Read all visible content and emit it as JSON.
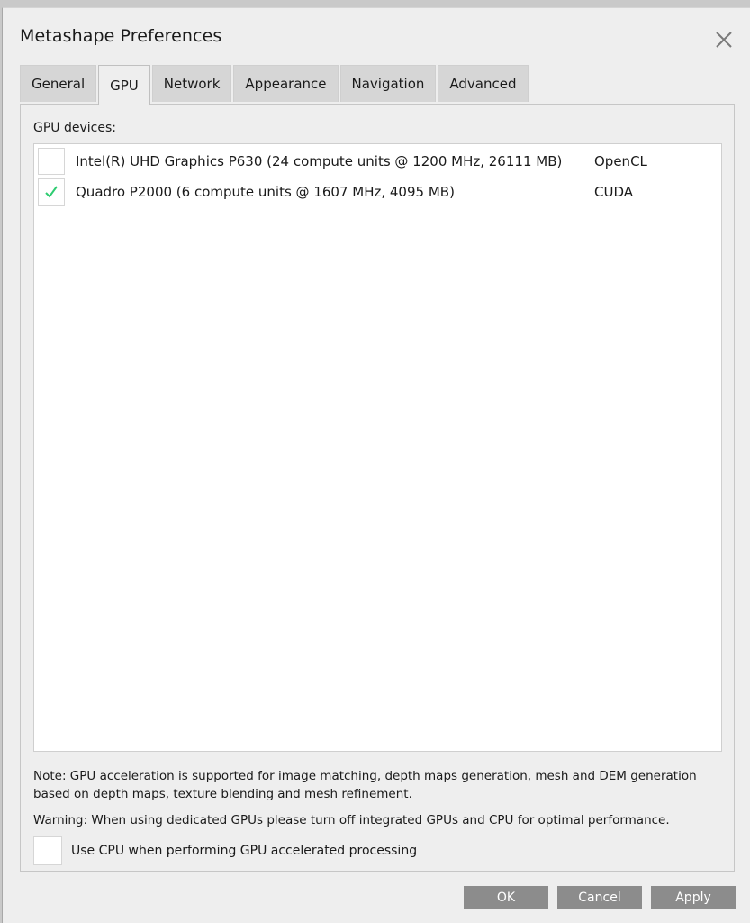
{
  "window": {
    "title": "Metashape Preferences",
    "close_icon": "close-icon"
  },
  "tabs": [
    {
      "label": "General",
      "active": false
    },
    {
      "label": "GPU",
      "active": true
    },
    {
      "label": "Network",
      "active": false
    },
    {
      "label": "Appearance",
      "active": false
    },
    {
      "label": "Navigation",
      "active": false
    },
    {
      "label": "Advanced",
      "active": false
    }
  ],
  "gpu": {
    "devices_label": "GPU devices:",
    "devices": [
      {
        "name": "Intel(R) UHD Graphics P630 (24 compute units @ 1200 MHz, 26111 MB)",
        "api": "OpenCL",
        "checked": false
      },
      {
        "name": "Quadro P2000 (6 compute units @ 1607 MHz, 4095 MB)",
        "api": "CUDA",
        "checked": true
      }
    ],
    "note": "Note: GPU acceleration is supported for image matching, depth maps generation, mesh and DEM generation based on depth maps, texture blending and mesh refinement.",
    "warning": "Warning: When using dedicated GPUs please turn off integrated GPUs and CPU for optimal performance.",
    "use_cpu_label": "Use CPU when performing GPU accelerated processing",
    "use_cpu_checked": false
  },
  "buttons": {
    "ok": "OK",
    "cancel": "Cancel",
    "apply": "Apply"
  },
  "colors": {
    "check_mark": "#2ecc71",
    "button_bg": "#8c8c8c",
    "dialog_bg": "#eeeeee"
  }
}
